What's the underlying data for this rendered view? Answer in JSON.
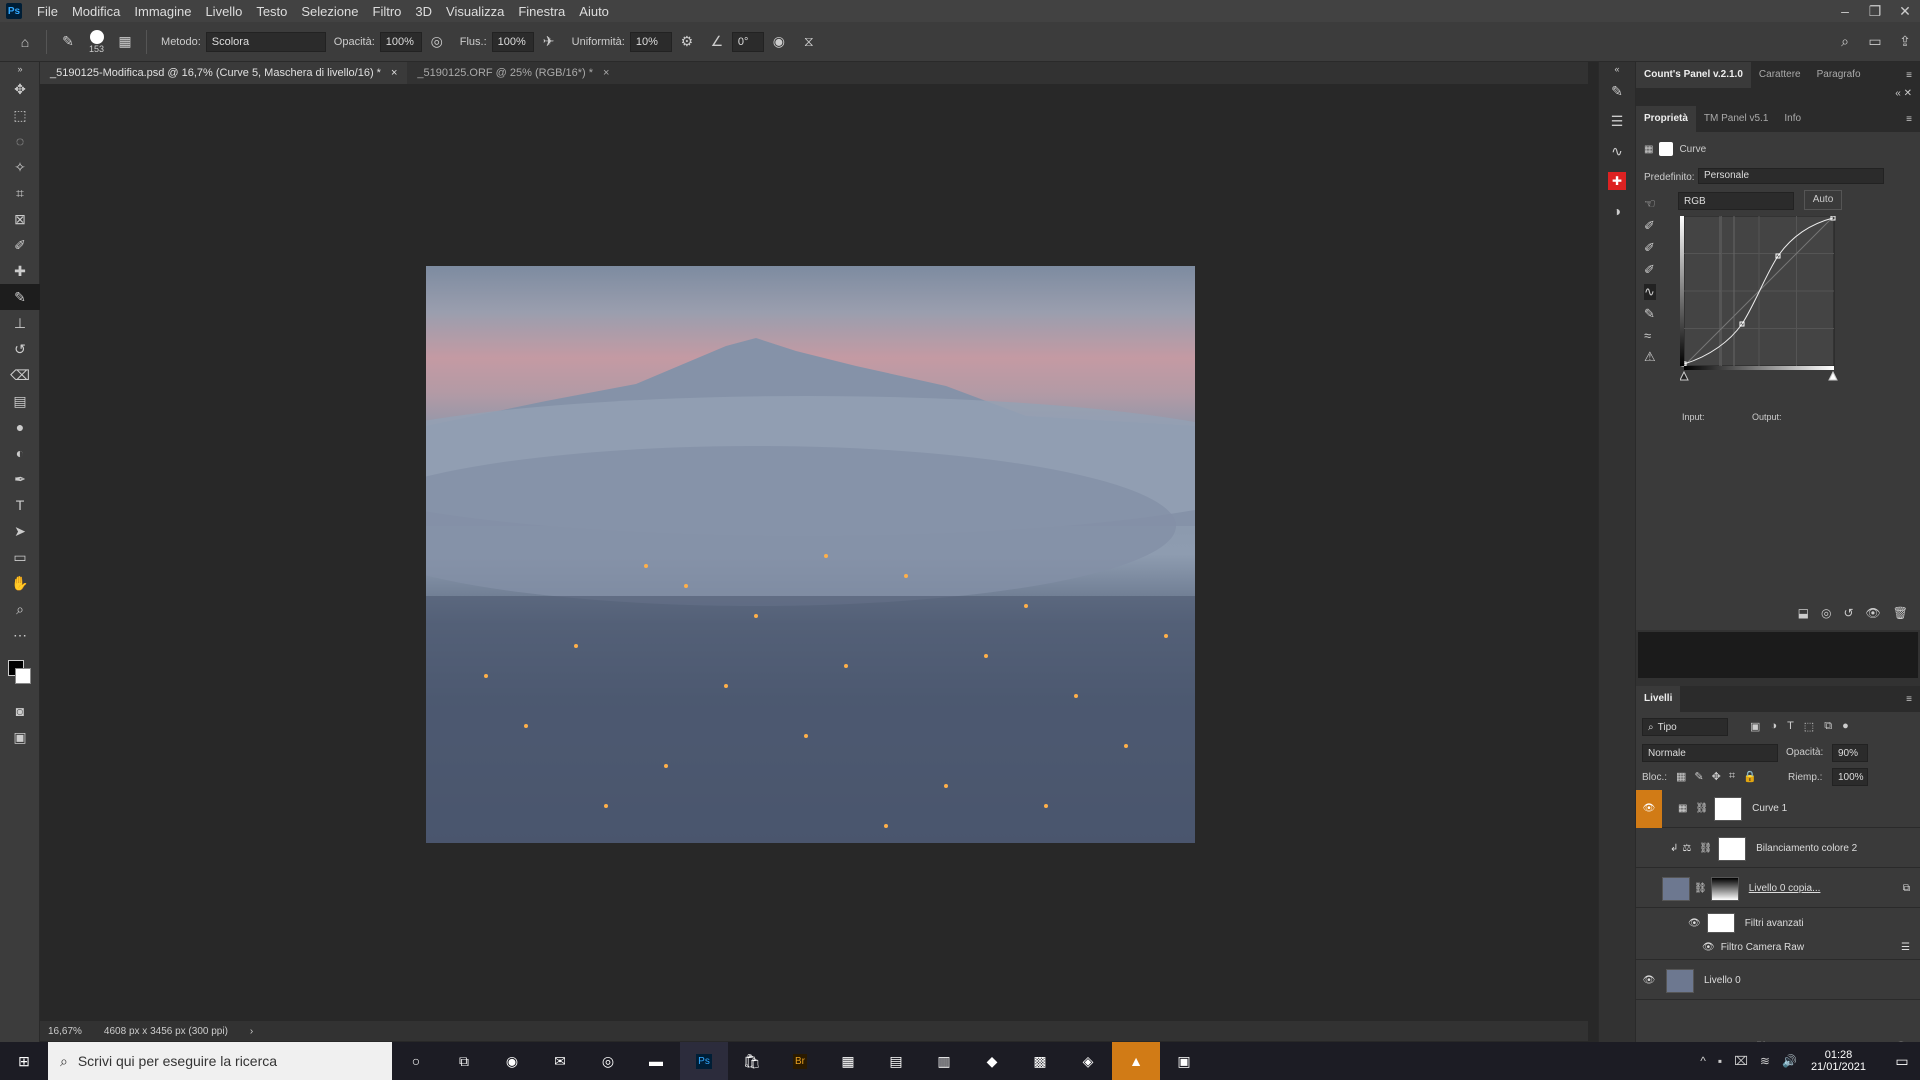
{
  "app": {
    "icon_text": "Ps"
  },
  "menu": [
    "File",
    "Modifica",
    "Immagine",
    "Livello",
    "Testo",
    "Selezione",
    "Filtro",
    "3D",
    "Visualizza",
    "Finestra",
    "Aiuto"
  ],
  "options": {
    "brush_size": "153",
    "mode_label": "Metodo:",
    "mode_value": "Scolora",
    "opacity_label": "Opacità:",
    "opacity_value": "100%",
    "flow_label": "Flus.:",
    "flow_value": "100%",
    "smooth_label": "Uniformità:",
    "smooth_value": "10%",
    "angle_value": "0°"
  },
  "tabs": [
    {
      "label": "_5190125-Modifica.psd @ 16,7% (Curve 5, Maschera di livello/16) *",
      "close": "×"
    },
    {
      "label": "_5190125.ORF @ 25% (RGB/16*) *",
      "close": "×"
    }
  ],
  "status": {
    "zoom": "16,67%",
    "doc_info": "4608 px x 3456 px (300 ppi)"
  },
  "top_panel_tabs": [
    "Count's Panel v.2.1.0",
    "Carattere",
    "Paragrafo"
  ],
  "props_tabs": [
    "Proprietà",
    "TM Panel v5.1",
    "Info"
  ],
  "props": {
    "adj_name": "Curve",
    "preset_label": "Predefinito:",
    "preset_value": "Personale",
    "channel_value": "RGB",
    "auto_label": "Auto",
    "input_label": "Input:",
    "output_label": "Output:"
  },
  "layers_panel": {
    "title": "Livelli",
    "filter_value": "Tipo",
    "blend_mode": "Normale",
    "opacity_label": "Opacità:",
    "opacity_value": "90%",
    "lock_label": "Bloc.:",
    "fill_label": "Riemp.:",
    "fill_value": "100%",
    "layers": [
      {
        "name": "Curve 1",
        "visible": true,
        "selected": true
      },
      {
        "name": "Bilanciamento colore 2",
        "visible": false
      },
      {
        "name": "Livello 0 copia...",
        "visible": false
      },
      {
        "name": "Filtri avanzati",
        "visible": true,
        "sub": true
      },
      {
        "name": "Filtro Camera Raw",
        "visible": true,
        "sub": true
      },
      {
        "name": "Livello 0",
        "visible": true
      }
    ]
  },
  "taskbar": {
    "search_placeholder": "Scrivi qui per eseguire la ricerca",
    "time": "01:28",
    "date": "21/01/2021"
  },
  "colors": {
    "accent": "#d17b16",
    "selected_tool": "#1d1d1d"
  }
}
